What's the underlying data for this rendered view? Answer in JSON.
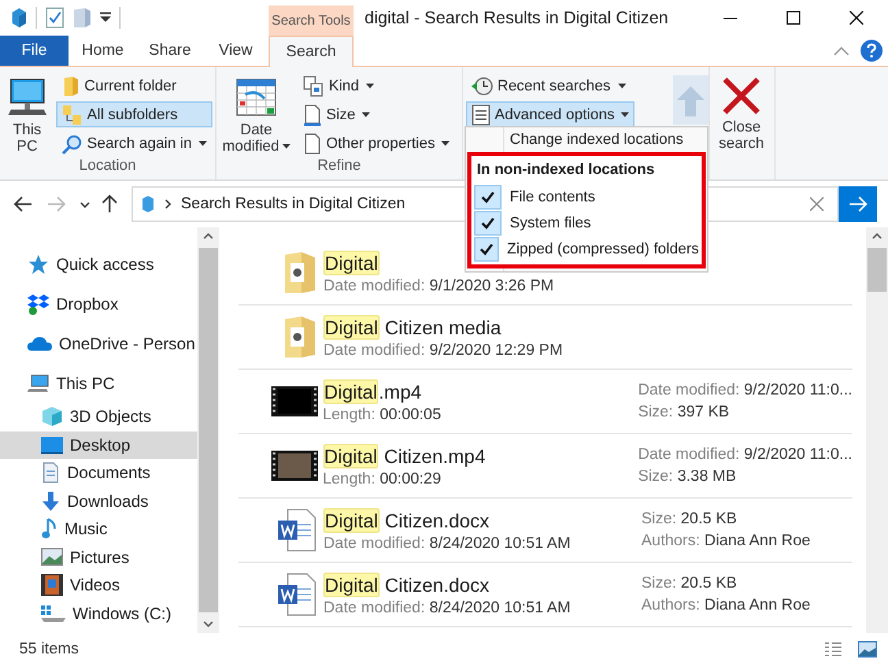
{
  "window": {
    "title": "digital - Search Results in Digital Citizen",
    "context_tab": "Search Tools"
  },
  "tabs": [
    {
      "label": "File",
      "kind": "file",
      "selected": false
    },
    {
      "label": "Home",
      "kind": "tab",
      "selected": false
    },
    {
      "label": "Share",
      "kind": "tab",
      "selected": false
    },
    {
      "label": "View",
      "kind": "tab",
      "selected": false
    },
    {
      "label": "Search",
      "kind": "tab",
      "selected": true
    }
  ],
  "ribbon": {
    "groups": [
      {
        "label": "Location",
        "items": [
          {
            "kind": "large",
            "label": "This PC",
            "dropdown": false
          },
          {
            "kind": "small",
            "label": "Current folder",
            "selected": false,
            "dropdown": false
          },
          {
            "kind": "small",
            "label": "All subfolders",
            "selected": true,
            "dropdown": false
          },
          {
            "kind": "small",
            "label": "Search again in",
            "selected": false,
            "dropdown": true
          }
        ]
      },
      {
        "label": "Refine",
        "items": [
          {
            "kind": "large",
            "label": "Date modified",
            "dropdown": true
          },
          {
            "kind": "small",
            "label": "Kind",
            "selected": false,
            "dropdown": true
          },
          {
            "kind": "small",
            "label": "Size",
            "selected": false,
            "dropdown": true
          },
          {
            "kind": "small",
            "label": "Other properties",
            "selected": false,
            "dropdown": true
          }
        ]
      },
      {
        "items": [
          {
            "kind": "small",
            "label": "Recent searches",
            "selected": false,
            "dropdown": true
          },
          {
            "kind": "small",
            "label": "Advanced options",
            "selected": true,
            "dropdown": true
          },
          {
            "kind": "large",
            "disabled": true
          }
        ]
      },
      {
        "items": [
          {
            "kind": "large",
            "label": "Close search",
            "dropdown": false
          }
        ]
      }
    ]
  },
  "advanced_menu": {
    "items": [
      {
        "label": "Change indexed locations"
      }
    ],
    "section": "In non-indexed locations",
    "options": [
      {
        "label": "File contents",
        "checked": true
      },
      {
        "label": "System files",
        "checked": true
      },
      {
        "label": "Zipped (compressed) folders",
        "checked": true
      }
    ]
  },
  "address": {
    "path": "Search Results in Digital Citizen"
  },
  "navigation": [
    {
      "label": "Quick access",
      "selected": false
    },
    {
      "label": "Dropbox",
      "selected": false
    },
    {
      "label": "OneDrive - Person",
      "selected": false
    },
    {
      "label": "This PC",
      "selected": false,
      "children": [
        {
          "label": "3D Objects",
          "selected": false
        },
        {
          "label": "Desktop",
          "selected": true
        },
        {
          "label": "Documents",
          "selected": false
        },
        {
          "label": "Downloads",
          "selected": false
        },
        {
          "label": "Music",
          "selected": false
        },
        {
          "label": "Pictures",
          "selected": false
        },
        {
          "label": "Videos",
          "selected": false
        },
        {
          "label": "Windows (C:)",
          "selected": false
        }
      ]
    }
  ],
  "files": [
    {
      "kind": "folder",
      "match": "Digital",
      "details": [
        {
          "label": "Date modified:",
          "value": "9/1/2020 3:26 PM"
        }
      ]
    },
    {
      "kind": "folder",
      "match": "Digital",
      "rest": " Citizen media",
      "details": [
        {
          "label": "Date modified:",
          "value": "9/2/2020 12:29 PM"
        }
      ]
    },
    {
      "kind": "video",
      "match": "Digital",
      "rest": ".mp4",
      "details": [
        {
          "label": "Length:",
          "value": "00:00:05"
        }
      ],
      "extra": [
        {
          "label": "Date modified:",
          "value": "9/2/2020 11:0..."
        },
        {
          "label": "Size:",
          "value": "397 KB"
        }
      ]
    },
    {
      "kind": "video",
      "match": "Digital",
      "rest": " Citizen.mp4",
      "details": [
        {
          "label": "Length:",
          "value": "00:00:29"
        }
      ],
      "extra": [
        {
          "label": "Date modified:",
          "value": "9/2/2020 11:0..."
        },
        {
          "label": "Size:",
          "value": "3.38 MB"
        }
      ]
    },
    {
      "kind": "document",
      "match": "Digital",
      "rest": " Citizen.docx",
      "details": [
        {
          "label": "Date modified:",
          "value": "8/24/2020 10:51 AM"
        }
      ],
      "extra": [
        {
          "label": "Size:",
          "value": "20.5 KB"
        },
        {
          "label": "Authors:",
          "value": "Diana Ann Roe"
        }
      ]
    },
    {
      "kind": "document",
      "match": "Digital",
      "rest": " Citizen.docx",
      "details": [
        {
          "label": "Date modified:",
          "value": "8/24/2020 10:51 AM"
        }
      ],
      "extra": [
        {
          "label": "Size:",
          "value": "20.5 KB"
        },
        {
          "label": "Authors:",
          "value": "Diana Ann Roe"
        }
      ]
    }
  ],
  "status_bar": {
    "count": "55 items"
  }
}
